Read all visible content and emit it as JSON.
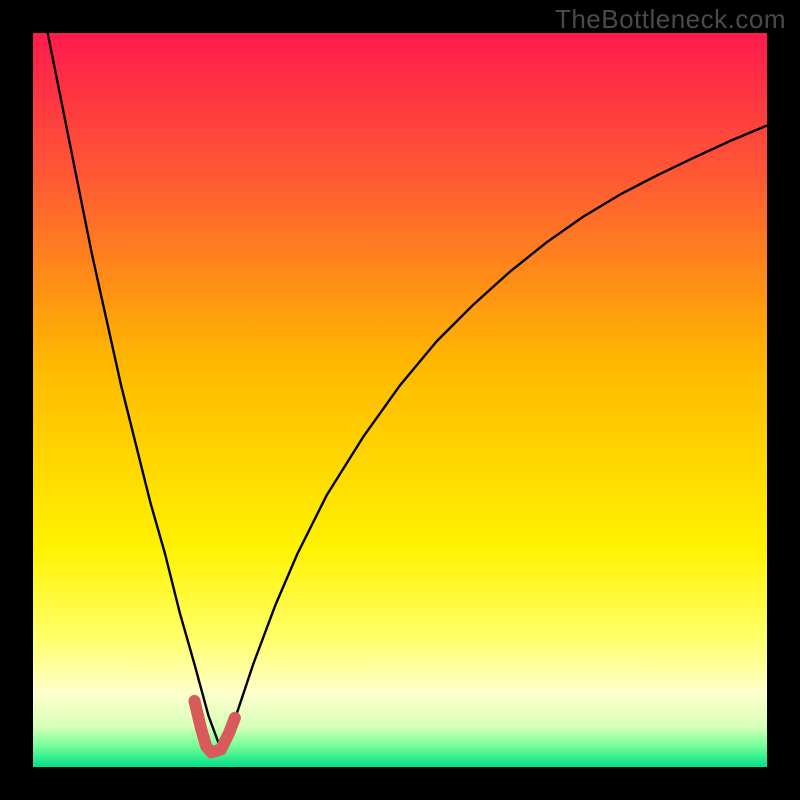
{
  "watermark": "TheBottleneck.com",
  "chart_data": {
    "type": "line",
    "title": "",
    "xlabel": "",
    "ylabel": "",
    "xlim": [
      0,
      100
    ],
    "ylim": [
      0,
      100
    ],
    "gradient_stops": [
      {
        "offset": 0.0,
        "color": "#ff1a4d"
      },
      {
        "offset": 0.2,
        "color": "#ff5a33"
      },
      {
        "offset": 0.45,
        "color": "#ffb800"
      },
      {
        "offset": 0.7,
        "color": "#fff200"
      },
      {
        "offset": 0.82,
        "color": "#ffff66"
      },
      {
        "offset": 0.9,
        "color": "#ffffcc"
      },
      {
        "offset": 0.945,
        "color": "#d7ffb8"
      },
      {
        "offset": 0.97,
        "color": "#7bff9a"
      },
      {
        "offset": 1.0,
        "color": "#00e08a"
      }
    ],
    "series": [
      {
        "name": "bottleneck-curve",
        "type": "line",
        "color": "#000000",
        "width": 2.4,
        "x": [
          0,
          2,
          4,
          6,
          8,
          10,
          12,
          14,
          16,
          18,
          20,
          22,
          23.9,
          25.6,
          27.5,
          30,
          33,
          36,
          40,
          45,
          50,
          55,
          60,
          65,
          70,
          75,
          80,
          85,
          90,
          95,
          100
        ],
        "values": [
          110,
          100,
          90,
          80,
          70,
          61,
          52,
          44,
          36,
          29,
          21,
          14,
          7,
          2.4,
          6.5,
          14,
          22,
          29,
          37,
          45,
          52,
          58,
          63,
          67.5,
          71.5,
          75,
          78,
          80.6,
          83,
          85.3,
          87.4
        ]
      },
      {
        "name": "optimal-zone",
        "type": "line",
        "color": "#d85a5a",
        "width": 12,
        "linecap": "round",
        "x": [
          22.0,
          22.9,
          23.6,
          24.3,
          25.6,
          26.7,
          27.5
        ],
        "values": [
          9.0,
          5.2,
          2.8,
          2.0,
          2.4,
          4.6,
          6.7
        ]
      }
    ]
  }
}
